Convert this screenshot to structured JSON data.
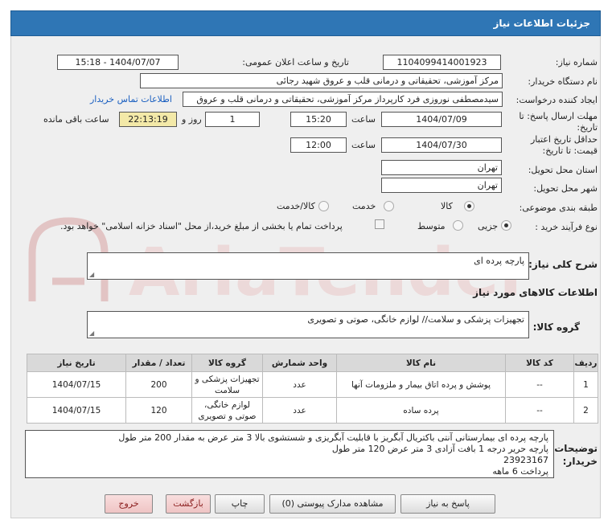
{
  "header": {
    "title": "جزئیات اطلاعات نیاز"
  },
  "need_number": {
    "label": "شماره نیاز:",
    "value": "1104099414001923"
  },
  "announce_date": {
    "label": "تاریخ و ساعت اعلان عمومی:",
    "value": "1404/07/07 - 15:18"
  },
  "buyer_org": {
    "label": "نام دستگاه خریدار:",
    "value": "مرکز آموزشی، تحقیقاتی و درمانی قلب و عروق شهید رجائی"
  },
  "requester": {
    "label": "ایجاد کننده درخواست:",
    "value": "سیدمصطفی نوروزی فرد کارپرداز مرکز آموزشی، تحقیقاتی و درمانی قلب و عروق",
    "contact_link": "اطلاعات تماس خریدار"
  },
  "response_deadline": {
    "label_line1": "مهلت ارسال پاسخ: تا",
    "label_line2": "تاریخ:",
    "date": "1404/07/09",
    "time_label": "ساعت",
    "time": "15:20",
    "days": "1",
    "days_label": "روز و",
    "remaining": "22:13:19",
    "remaining_label": "ساعت باقی مانده"
  },
  "price_validity": {
    "label_line1": "حداقل تاریخ اعتبار",
    "label_line2": "قیمت: تا تاریخ:",
    "date": "1404/07/30",
    "time_label": "ساعت",
    "time": "12:00"
  },
  "province": {
    "label": "استان محل تحویل:",
    "value": "تهران"
  },
  "city": {
    "label": "شهر محل تحویل:",
    "value": "تهران"
  },
  "category": {
    "label": "طبقه بندی موضوعی:",
    "options": [
      "کالا",
      "خدمت",
      "کالا/خدمت"
    ],
    "selected": "کالا"
  },
  "process": {
    "label": "نوع فرآیند خرید :",
    "options": [
      "جزیی",
      "متوسط"
    ],
    "selected": "جزیی",
    "treasury_note": "پرداخت تمام یا بخشی از مبلغ خرید،از محل \"اسناد خزانه اسلامی\" خواهد بود."
  },
  "general_desc": {
    "label": "شرح کلی نیاز:",
    "value": "پارچه پرده ای"
  },
  "goods_info_title": "اطلاعات کالاهای مورد نیاز",
  "goods_group": {
    "label": "گروه کالا:",
    "value": "تجهیزات پزشکی و سلامت// لوازم خانگی، صوتی و تصویری"
  },
  "table": {
    "headers": [
      "ردیف",
      "کد کالا",
      "نام کالا",
      "واحد شمارش",
      "گروه کالا",
      "تعداد / مقدار",
      "تاریخ نیاز"
    ],
    "rows": [
      [
        "1",
        "--",
        "پوشش و پرده اتاق بیمار و ملزومات آنها",
        "عدد",
        "تجهیزات پزشکی و سلامت",
        "200",
        "1404/07/15"
      ],
      [
        "2",
        "--",
        "پرده ساده",
        "عدد",
        "لوازم خانگی، صوتی و تصویری",
        "120",
        "1404/07/15"
      ]
    ]
  },
  "buyer_notes": {
    "label_line1": "توضیحات",
    "label_line2": "خریدار:",
    "lines": [
      "پارچه پرده ای بیمارستانی آنتی باکتریال آبگریز با قابلیت آبگریزی و شستشوی بالا 3 متر عرض به مقدار 200 متر طول",
      "پارچه حریر درجه 1 بافت آزادی 3 متر عرض 120 متر طول",
      "23923167",
      "پرداخت 6 ماهه"
    ]
  },
  "buttons": {
    "reply": "پاسخ به نیاز",
    "attachments": "مشاهده مدارک پیوستی (0)",
    "print": "چاپ",
    "back": "بازگشت",
    "exit": "خروج"
  },
  "watermark": {
    "text": "AriaTender.net",
    "color": "#d9a9a9"
  }
}
